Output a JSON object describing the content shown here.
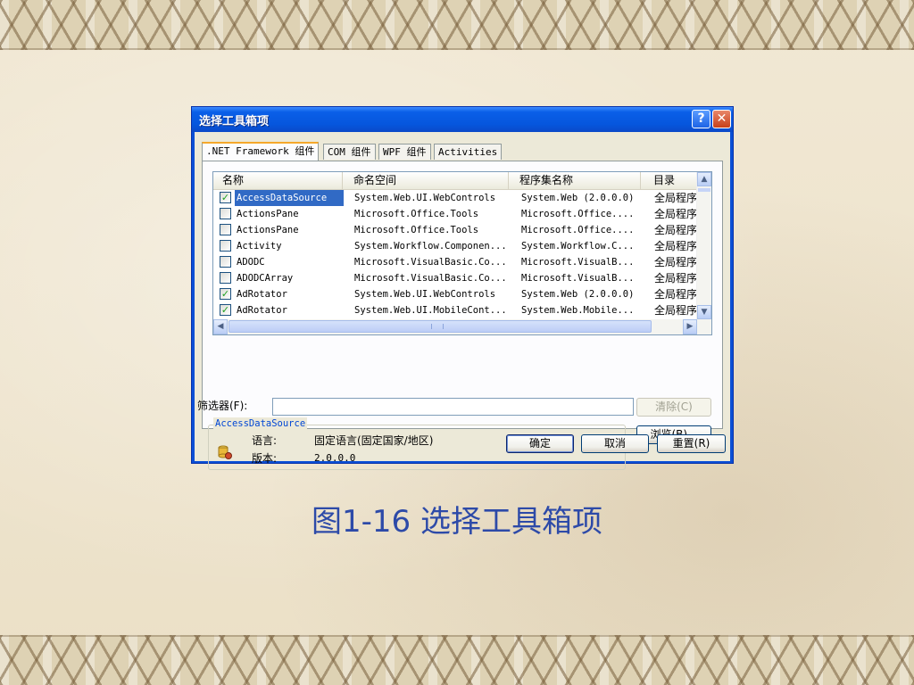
{
  "dialog": {
    "title": "选择工具箱项",
    "help_button": "?",
    "close_button": "✕",
    "tabs": [
      {
        "label": ".NET Framework 组件",
        "active": true
      },
      {
        "label": "COM 组件",
        "active": false
      },
      {
        "label": "WPF 组件",
        "active": false
      },
      {
        "label": "Activities",
        "active": false
      }
    ],
    "columns": {
      "name": "名称",
      "namespace": "命名空间",
      "assembly": "程序集名称",
      "directory": "目录"
    },
    "rows": [
      {
        "checked": true,
        "selected": true,
        "name": "AccessDataSource",
        "namespace": "System.Web.UI.WebControls",
        "assembly": "System.Web (2.0.0.0)",
        "directory": "全局程序"
      },
      {
        "checked": false,
        "selected": false,
        "name": "ActionsPane",
        "namespace": "Microsoft.Office.Tools",
        "assembly": "Microsoft.Office....",
        "directory": "全局程序"
      },
      {
        "checked": false,
        "selected": false,
        "name": "ActionsPane",
        "namespace": "Microsoft.Office.Tools",
        "assembly": "Microsoft.Office....",
        "directory": "全局程序"
      },
      {
        "checked": false,
        "selected": false,
        "name": "Activity",
        "namespace": "System.Workflow.Componen...",
        "assembly": "System.Workflow.C...",
        "directory": "全局程序"
      },
      {
        "checked": false,
        "selected": false,
        "name": "ADODC",
        "namespace": "Microsoft.VisualBasic.Co...",
        "assembly": "Microsoft.VisualB...",
        "directory": "全局程序"
      },
      {
        "checked": false,
        "selected": false,
        "name": "ADODCArray",
        "namespace": "Microsoft.VisualBasic.Co...",
        "assembly": "Microsoft.VisualB...",
        "directory": "全局程序"
      },
      {
        "checked": true,
        "selected": false,
        "name": "AdRotator",
        "namespace": "System.Web.UI.WebControls",
        "assembly": "System.Web (2.0.0.0)",
        "directory": "全局程序"
      },
      {
        "checked": true,
        "selected": false,
        "name": "AdRotator",
        "namespace": "System.Web.UI.MobileCont...",
        "assembly": "System.Web.Mobile...",
        "directory": "全局程序"
      }
    ],
    "filter_label": "筛选器(F):",
    "filter_value": "",
    "clear_button": "清除(C)",
    "browse_button": "浏览(B)...",
    "group_title": "AccessDataSource",
    "language_label": "语言:",
    "language_value": "固定语言(固定国家/地区)",
    "version_label": "版本:",
    "version_value": "2.0.0.0",
    "ok_button": "确定",
    "cancel_button": "取消",
    "reset_button": "重置(R)"
  },
  "caption": "图1-16 选择工具箱项",
  "colors": {
    "titlebar": "#0656dd",
    "selection": "#316ac5",
    "caption": "#2d4aa8",
    "group_title": "#0046d5"
  }
}
